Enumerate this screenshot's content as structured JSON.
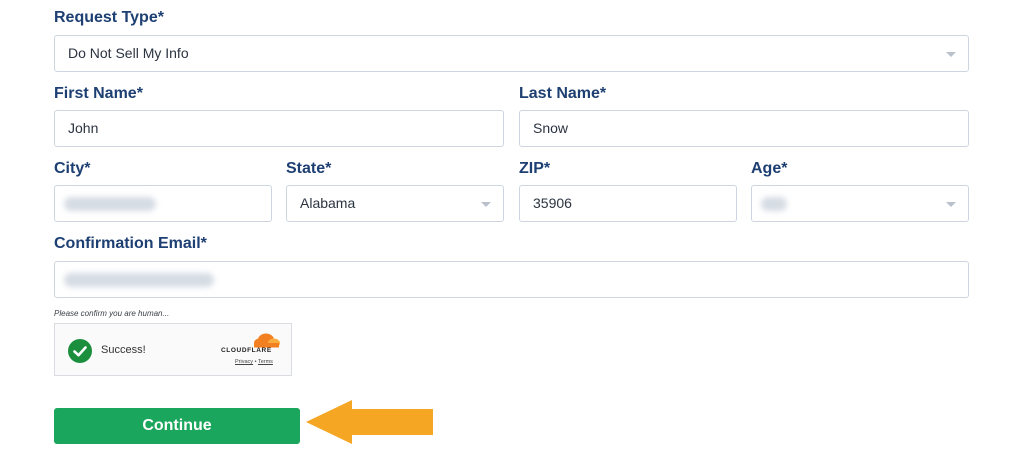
{
  "request_type": {
    "label": "Request Type*",
    "value": "Do Not Sell My Info"
  },
  "first_name": {
    "label": "First Name*",
    "value": "John"
  },
  "last_name": {
    "label": "Last Name*",
    "value": "Snow"
  },
  "city": {
    "label": "City*"
  },
  "state": {
    "label": "State*",
    "value": "Alabama"
  },
  "zip": {
    "label": "ZIP*",
    "value": "35906"
  },
  "age": {
    "label": "Age*"
  },
  "email": {
    "label": "Confirmation Email*"
  },
  "captcha": {
    "prompt": "Please confirm you are human...",
    "status": "Success!",
    "brand": "CLOUDFLARE",
    "privacy_link": "Privacy",
    "separator": "•",
    "terms_link": "Terms"
  },
  "continue_button": {
    "label": "Continue"
  },
  "colors": {
    "label": "#1d3f72",
    "continue": "#1aa65c",
    "success": "#1b8f3e",
    "arrow": "#f5a623",
    "cloudflare": "#f38020"
  },
  "icons": [
    "chevron-down-icon",
    "checkmark-icon",
    "cloudflare-cloud-icon",
    "arrow-left-icon"
  ]
}
